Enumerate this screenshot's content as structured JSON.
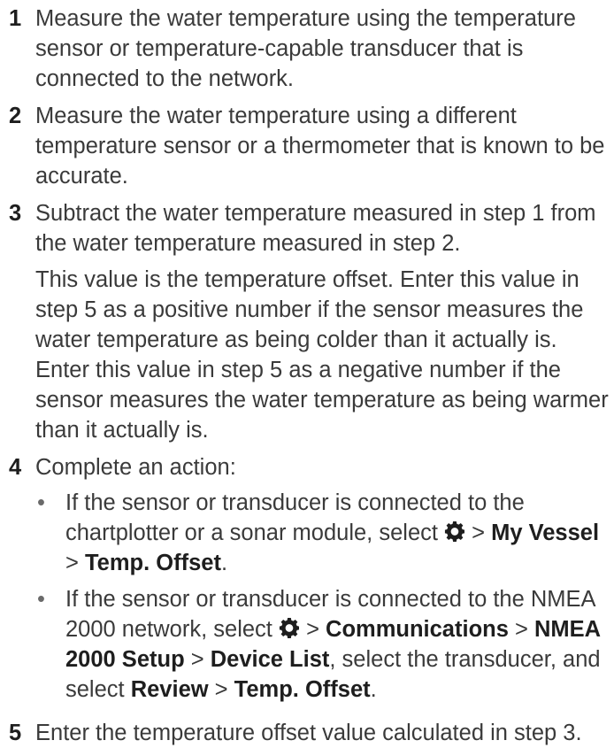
{
  "steps": [
    {
      "num": "1",
      "text": "Measure the water temperature using the temperature sensor or temperature-capable transducer that is connected to the network."
    },
    {
      "num": "2",
      "text": "Measure the water temperature using a different temperature sensor or a thermometer that is known to be accurate."
    },
    {
      "num": "3",
      "text": "Subtract the water temperature measured in step 1 from the water temperature measured in step 2.",
      "note": "This value is the temperature offset. Enter this value in step 5 as a positive number if the sensor measures the water temperature as being colder than it actually is. Enter this value in step 5 as a negative number if the sensor measures the water temperature as being warmer than it actually is."
    },
    {
      "num": "4",
      "text": "Complete an action:",
      "bullets": [
        {
          "bullet": "•",
          "lead": "If the sensor or transducer is connected to the chartplotter or a sonar module, select",
          "sep1": " > ",
          "b1": "My Vessel",
          "sep2": " > ",
          "b2": "Temp. Offset",
          "end": "."
        },
        {
          "bullet": "•",
          "lead": "If the sensor or transducer is connected to the NMEA 2000 network, select",
          "sep1": " > ",
          "b1": "Communications",
          "sep2": " > ",
          "b2": "NMEA 2000 Setup",
          "sep3": " > ",
          "b3": "Device List",
          "mid": ", select the transducer, and select ",
          "b4": "Review",
          "sep4": " > ",
          "b5": "Temp. Offset",
          "end": "."
        }
      ]
    },
    {
      "num": "5",
      "text": "Enter the temperature offset value calculated in step 3."
    }
  ],
  "icons": {
    "settings": "gear-icon"
  },
  "colors": {
    "text": "#3a3a3a",
    "emphasis": "#1e1e1e"
  }
}
